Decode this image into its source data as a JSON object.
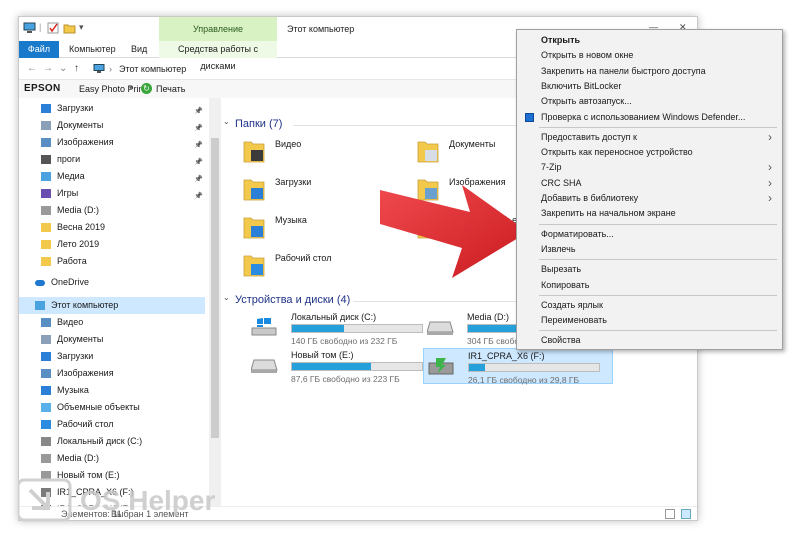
{
  "titlebar": {
    "contextual_group": "Управление",
    "window_title": "Этот компьютер",
    "minimize": "—",
    "close": "✕"
  },
  "ribbon": {
    "file": "Файл",
    "computer": "Компьютер",
    "view": "Вид",
    "disk_tools": "Средства работы с дисками"
  },
  "address": {
    "back": "←",
    "forward": "→",
    "dropdown": "⌄",
    "up": "↑",
    "path": "Этот компьютер"
  },
  "epson_bar": {
    "logo": "EPSON",
    "app": "Easy Photo Print",
    "print": "Печать"
  },
  "sidebar": {
    "items": [
      {
        "label": "Загрузки",
        "icon": "downloads-icon",
        "pinned": true
      },
      {
        "label": "Документы",
        "icon": "documents-icon",
        "pinned": true
      },
      {
        "label": "Изображения",
        "icon": "pictures-icon",
        "pinned": true
      },
      {
        "label": "проги",
        "icon": "folder-dark-icon",
        "pinned": true
      },
      {
        "label": "Медиа",
        "icon": "media-icon",
        "pinned": true
      },
      {
        "label": "Игры",
        "icon": "games-icon",
        "pinned": true
      },
      {
        "label": "Media (D:)",
        "icon": "drive-icon",
        "pinned": false
      },
      {
        "label": "Весна 2019",
        "icon": "folder-icon",
        "pinned": false
      },
      {
        "label": "Лето 2019",
        "icon": "folder-icon",
        "pinned": false
      },
      {
        "label": "Работа",
        "icon": "folder-icon",
        "pinned": false
      },
      {
        "label": "OneDrive",
        "icon": "onedrive-icon",
        "pinned": false
      },
      {
        "label": "Этот компьютер",
        "icon": "computer-icon",
        "pinned": false
      },
      {
        "label": "Видео",
        "icon": "videos-icon",
        "pinned": false
      },
      {
        "label": "Документы",
        "icon": "documents-icon",
        "pinned": false
      },
      {
        "label": "Загрузки",
        "icon": "downloads-icon",
        "pinned": false
      },
      {
        "label": "Изображения",
        "icon": "pictures-icon",
        "pinned": false
      },
      {
        "label": "Музыка",
        "icon": "music-icon",
        "pinned": false
      },
      {
        "label": "Объемные объекты",
        "icon": "3d-objects-icon",
        "pinned": false
      },
      {
        "label": "Рабочий стол",
        "icon": "desktop-icon",
        "pinned": false
      },
      {
        "label": "Локальный диск (C:)",
        "icon": "drive-c-icon",
        "pinned": false
      },
      {
        "label": "Media (D:)",
        "icon": "drive-icon",
        "pinned": false
      },
      {
        "label": "Новый том (E:)",
        "icon": "drive-icon",
        "pinned": false
      },
      {
        "label": "IR1_CPRA_X6 (F:)",
        "icon": "dvd-icon",
        "pinned": false
      },
      {
        "label": "IR1_CPRA_X6 (F:)",
        "icon": "dvd-icon",
        "pinned": false
      }
    ]
  },
  "content": {
    "folders_header": "Папки (7)",
    "folders": [
      {
        "label": "Видео",
        "icon": "videos-folder-icon"
      },
      {
        "label": "Документы",
        "icon": "documents-folder-icon"
      },
      {
        "label": "Загрузки",
        "icon": "downloads-folder-icon"
      },
      {
        "label": "Изображения",
        "icon": "pictures-folder-icon"
      },
      {
        "label": "Музыка",
        "icon": "music-folder-icon"
      },
      {
        "label": "Объемные объекты",
        "icon": "3d-objects-folder-icon"
      },
      {
        "label": "Рабочий стол",
        "icon": "desktop-folder-icon"
      }
    ],
    "drives_header": "Устройства и диски (4)",
    "drives": [
      {
        "name": "Локальный диск (C:)",
        "free": "140 ГБ свободно из 232 ГБ",
        "used_fraction": 0.4,
        "icon": "windows-drive-icon"
      },
      {
        "name": "Media (D:)",
        "free": "304 ГБ свободно из 931 ГБ",
        "used_fraction": 0.67,
        "icon": "hdd-icon"
      },
      {
        "name": "Новый том (E:)",
        "free": "87,6 ГБ свободно из 223 ГБ",
        "used_fraction": 0.61,
        "icon": "hdd-icon"
      },
      {
        "name": "IR1_CPRA_X6 (F:)",
        "free": "26,1 ГБ свободно из 29,8 ГБ",
        "used_fraction": 0.12,
        "icon": "usb-drive-icon"
      }
    ]
  },
  "status": {
    "count": "Элементов: 11",
    "selected": "Выбран 1 элемент"
  },
  "context_menu": {
    "items": [
      {
        "label": "Открыть",
        "bold": true,
        "submenu": false,
        "sep_after": false
      },
      {
        "label": "Открыть в новом окне",
        "bold": false,
        "submenu": false,
        "sep_after": false
      },
      {
        "label": "Закрепить на панели быстрого доступа",
        "bold": false,
        "submenu": false,
        "sep_after": false
      },
      {
        "label": "Включить BitLocker",
        "bold": false,
        "submenu": false,
        "sep_after": false
      },
      {
        "label": "Открыть автозапуск...",
        "bold": false,
        "submenu": false,
        "sep_after": false
      },
      {
        "label": "Проверка с использованием Windows Defender...",
        "bold": false,
        "submenu": false,
        "sep_after": true,
        "icon": "defender-icon"
      },
      {
        "label": "Предоставить доступ к",
        "bold": false,
        "submenu": true,
        "sep_after": false
      },
      {
        "label": "Открыть как переносное устройство",
        "bold": false,
        "submenu": false,
        "sep_after": false
      },
      {
        "label": "7-Zip",
        "bold": false,
        "submenu": true,
        "sep_after": false
      },
      {
        "label": "CRC SHA",
        "bold": false,
        "submenu": true,
        "sep_after": false
      },
      {
        "label": "Добавить в библиотеку",
        "bold": false,
        "submenu": true,
        "sep_after": false
      },
      {
        "label": "Закрепить на начальном экране",
        "bold": false,
        "submenu": false,
        "sep_after": true
      },
      {
        "label": "Форматировать...",
        "bold": false,
        "submenu": false,
        "sep_after": false
      },
      {
        "label": "Извлечь",
        "bold": false,
        "submenu": false,
        "sep_after": true
      },
      {
        "label": "Вырезать",
        "bold": false,
        "submenu": false,
        "sep_after": false
      },
      {
        "label": "Копировать",
        "bold": false,
        "submenu": false,
        "sep_after": true
      },
      {
        "label": "Создать ярлык",
        "bold": false,
        "submenu": false,
        "sep_after": false
      },
      {
        "label": "Переименовать",
        "bold": false,
        "submenu": false,
        "sep_after": true
      },
      {
        "label": "Свойства",
        "bold": false,
        "submenu": false,
        "sep_after": false
      }
    ]
  },
  "watermark": {
    "text": "OS Helper"
  },
  "colors": {
    "accent": "#1979ca",
    "bar_fill": "#26a0da",
    "arrow": "#e8262b",
    "menu_bg": "#f2f2f2"
  }
}
